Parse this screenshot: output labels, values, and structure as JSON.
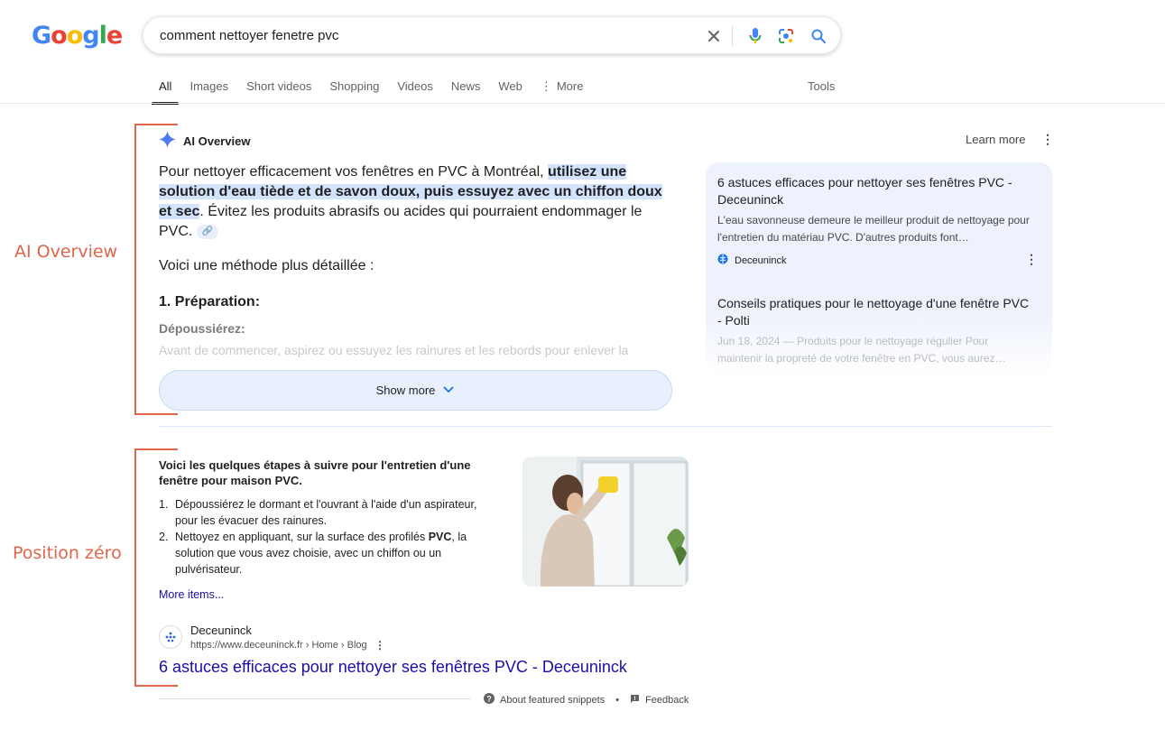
{
  "logo": [
    "G",
    "o",
    "o",
    "g",
    "l",
    "e"
  ],
  "search": {
    "query": "comment nettoyer fenetre pvc"
  },
  "tabs": [
    {
      "label": "All"
    },
    {
      "label": "Images"
    },
    {
      "label": "Short videos"
    },
    {
      "label": "Shopping"
    },
    {
      "label": "Videos"
    },
    {
      "label": "News"
    },
    {
      "label": "Web"
    },
    {
      "label": "More"
    }
  ],
  "tools_label": "Tools",
  "annotations": {
    "ai": "AI Overview",
    "fs": "Position zéro"
  },
  "ai": {
    "heading": "AI Overview",
    "learn_more": "Learn more",
    "para_pre": "Pour nettoyer efficacement vos fenêtres en PVC à Montréal, ",
    "para_hl": "utilisez une solution d'eau tiède et de savon doux, puis essuyez avec un chiffon doux et sec",
    "para_post": ". Évitez les produits abrasifs ou acides qui pourraient endommager le PVC.",
    "method": "Voici une méthode plus détaillée :",
    "step1": "1. Préparation:",
    "sub1": "Dépoussiérez:",
    "fade": "Avant de commencer, aspirez ou essuyez les rainures et les rebords pour enlever la",
    "show_more": "Show more",
    "sources": [
      {
        "title": "6 astuces efficaces pour nettoyer ses fenêtres PVC - Deceuninck",
        "snippet": "L'eau savonneuse demeure le meilleur produit de nettoyage pour l'entretien du matériau PVC. D'autres produits font…",
        "site": "Deceuninck"
      },
      {
        "title": "Conseils pratiques pour le nettoyage d'une fenêtre PVC - Polti",
        "snippet": "Jun 18, 2024 — Produits pour le nettoyage régulier Pour maintenir la propreté de votre fenêtre en PVC, vous aurez…"
      }
    ]
  },
  "featured": {
    "title": "Voici les quelques étapes à suivre pour l'entretien d'une fenêtre pour maison PVC.",
    "items": [
      {
        "num": "1.",
        "pre": "Dépoussiérez le dormant et l'ouvrant à l'aide d'un aspirateur, pour les évacuer des rainures.",
        "bold": "",
        "post": ""
      },
      {
        "num": "2.",
        "pre": "Nettoyez en appliquant, sur la surface des profilés ",
        "bold": "PVC",
        "post": ", la solution que vous avez choisie, avec un chiffon ou un pulvérisateur."
      }
    ],
    "more_items": "More items...",
    "site_name": "Deceuninck",
    "site_url": "https://www.deceuninck.fr › Home › Blog",
    "result_title": "6 astuces efficaces pour nettoyer ses fenêtres PVC - Deceuninck",
    "about": "About featured snippets",
    "sep": "•",
    "feedback": "Feedback"
  },
  "colors": {
    "accent": "#1a0dab",
    "annotation": "#e0654a",
    "highlight": "#d3e3fd"
  }
}
